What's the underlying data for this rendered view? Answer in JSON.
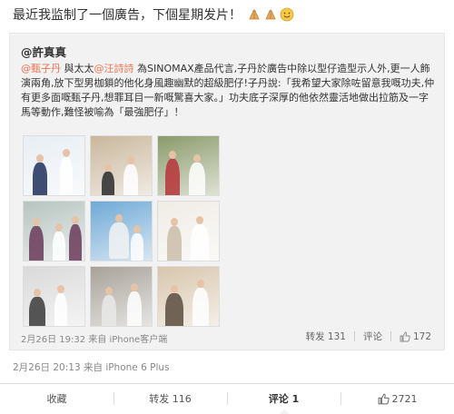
{
  "post": {
    "text": "最近我监制了一個廣告，下個星期发片！",
    "emojis": [
      "pray-hands-icon",
      "pray-hands-icon",
      "smile-icon"
    ]
  },
  "repost": {
    "author": "@許真真",
    "body_parts": [
      {
        "type": "mention",
        "text": "@甄子丹"
      },
      {
        "type": "text",
        "text": " 與太太"
      },
      {
        "type": "mention",
        "text": "@汪詩詩"
      },
      {
        "type": "text",
        "text": " 為SINOMAX產品代言,子丹於廣告中除以型仔造型示人外,更一人飾演兩角,放下型男枷鎖的他化身風趣幽默的超級肥仔!子丹說:「我希望大家除咗留意我嘅功夫,仲有更多面嘅甄子丹,想罪耳目一新嘅驚喜大家。」功夫底子深厚的他依然靈活地做出拉筋及一字馬等動作,難怪被喻為「最強肥仔」！"
      }
    ],
    "meta": "2月26日 19:32 来自 iPhone客户端",
    "actions": {
      "repost_label": "转发 131",
      "comment_label": "评论",
      "like_count": "172"
    }
  },
  "thumbnails": [
    {
      "name": "photo-1",
      "bg": "#e8eef4",
      "accent": "#1e2f5a"
    },
    {
      "name": "photo-2",
      "bg": "#c9b79c",
      "accent": "#2c2c2c"
    },
    {
      "name": "photo-3",
      "bg": "#8a9a6a",
      "accent": "#b8323a"
    },
    {
      "name": "photo-4",
      "bg": "#b6c4c0",
      "accent": "#6b3a5a"
    },
    {
      "name": "photo-5",
      "bg": "#6fa9d6",
      "accent": "#f2f2f2"
    },
    {
      "name": "photo-6",
      "bg": "#f0ece6",
      "accent": "#c9bda8"
    },
    {
      "name": "photo-7",
      "bg": "#d9d9d9",
      "accent": "#3a3a3a"
    },
    {
      "name": "photo-8",
      "bg": "#a7a299",
      "accent": "#e9e9e9"
    },
    {
      "name": "photo-9",
      "bg": "#d8c6ad",
      "accent": "#5a4c40"
    }
  ],
  "post_meta": "2月26日 20:13 来自 iPhone 6 Plus",
  "bottom_bar": {
    "collect": "收藏",
    "repost": "转发 116",
    "comment": "评论 1",
    "like": "2721"
  },
  "colors": {
    "mention": "#eb7350",
    "repost_bg": "#f2f2f2",
    "like": "#999999"
  }
}
